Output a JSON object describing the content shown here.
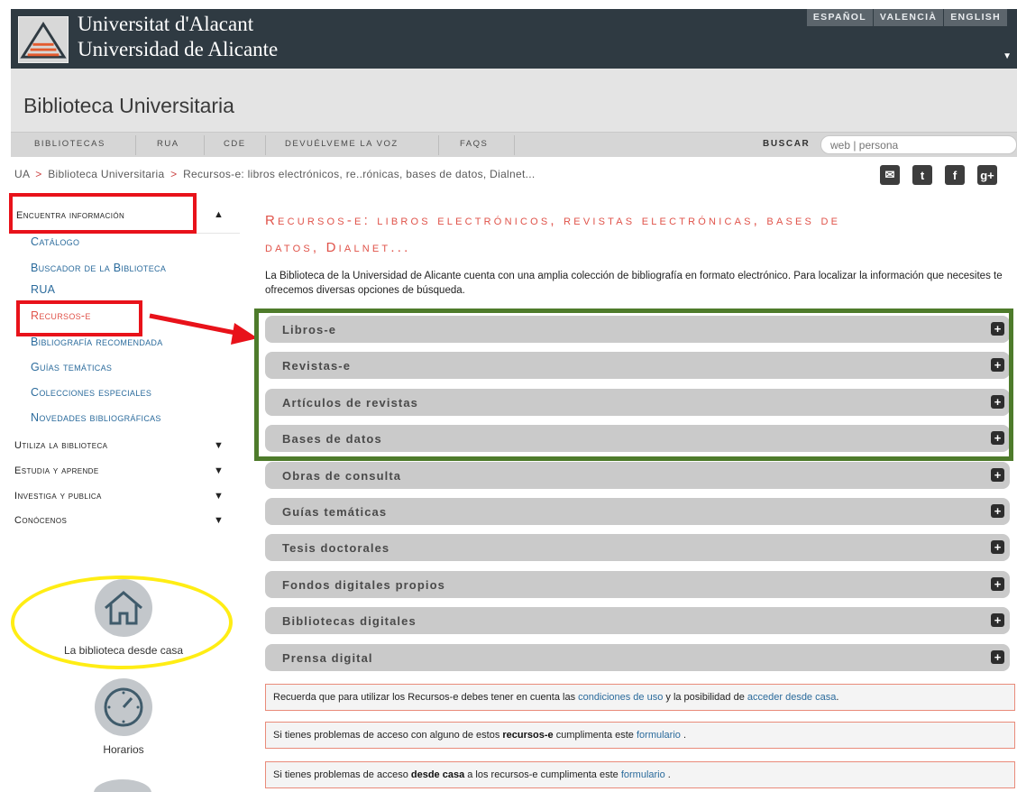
{
  "header": {
    "line1": "Universitat d'Alacant",
    "line2": "Universidad de Alicante",
    "languages": [
      "ESPAÑOL",
      "VALENCIÀ",
      "ENGLISH"
    ]
  },
  "library": {
    "title": "Biblioteca Universitaria",
    "nav": [
      "BIBLIOTECAS",
      "RUA",
      "CDE",
      "DEVUÉLVEME LA VOZ",
      "FAQS"
    ],
    "search_label": "BUSCAR",
    "search_placeholder": "web | persona"
  },
  "breadcrumb": {
    "items": [
      "UA",
      "Biblioteca Universitaria",
      "Recursos-e: libros electrónicos, re..rónicas, bases de datos, Dialnet..."
    ],
    "separator": ">"
  },
  "social": {
    "icons": [
      "inbox-icon",
      "twitter-icon",
      "facebook-icon",
      "google-plus-icon"
    ],
    "glyphs": [
      "✉",
      "t",
      "f",
      "g+"
    ]
  },
  "sidebar": {
    "heading": "Encuentra información",
    "links": [
      "Catálogo",
      "Buscador de la Biblioteca",
      "RUA",
      "Recursos-e",
      "Bibliografía recomendada",
      "Guías temáticas",
      "Colecciones especiales",
      "Novedades bibliográficas"
    ],
    "active_index": 3,
    "sections": [
      "Utiliza la biblioteca",
      "Estudia y aprende",
      "Investiga y publica",
      "Conócenos"
    ],
    "tiles": [
      "La biblioteca desde casa",
      "Horarios"
    ]
  },
  "main": {
    "title_line1": "Recursos-e: libros electrónicos, revistas electrónicas, bases de",
    "title_line2": "datos, Dialnet...",
    "intro": "La Biblioteca de la Universidad de Alicante cuenta con una amplia colección de bibliografía en formato electrónico. Para localizar la información que necesites te ofrecemos diversas opciones de búsqueda.",
    "accordion": [
      "Libros-e",
      "Revistas-e",
      "Artículos de revistas",
      "Bases de datos",
      "Obras de consulta",
      "Guías temáticas",
      "Tesis doctorales",
      "Fondos digitales propios",
      "Bibliotecas digitales",
      "Prensa digital"
    ],
    "notices": [
      {
        "t1": "Recuerda que para utilizar los Recursos-e debes tener en cuenta las ",
        "link1": "condiciones de uso",
        "t2": " y la posibilidad de ",
        "link2": "acceder desde casa",
        "t3": "."
      },
      {
        "t1": "Si tienes problemas de acceso con alguno de estos ",
        "bold": "recursos-e",
        "t2": " cumplimenta este ",
        "link": "formulario",
        "t3": " ."
      },
      {
        "t1": "Si tienes problemas de acceso ",
        "bold": "desde casa",
        "t2": " a los recursos-e cumplimenta este ",
        "link": "formulario",
        "t3": " ."
      }
    ]
  },
  "colors": {
    "accent_red": "#e0534a",
    "link_blue": "#2b6b9c",
    "highlight_red": "#e8121a",
    "highlight_green": "#4e7b2b",
    "highlight_yellow": "#ffed14"
  }
}
